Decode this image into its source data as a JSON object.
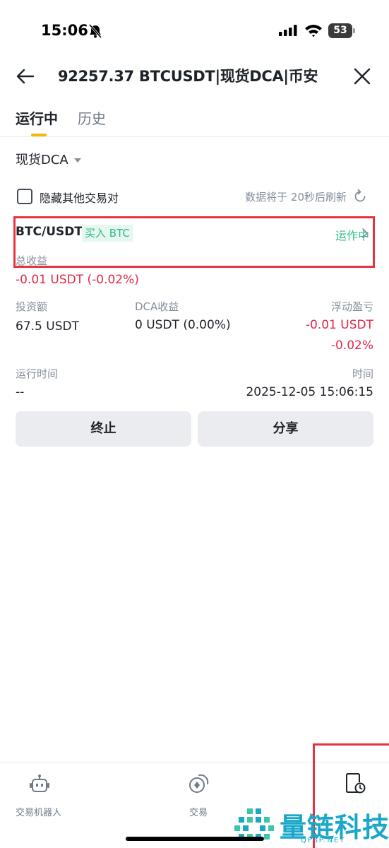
{
  "status_bar": {
    "time": "15:06",
    "battery": "53"
  },
  "nav": {
    "title": "92257.37 BTCUSDT|现货DCA|币安"
  },
  "tabs": [
    {
      "label": "运行中"
    },
    {
      "label": "历史"
    }
  ],
  "filter": {
    "label": "现货DCA"
  },
  "options": {
    "hide_label": "隐藏其他交易对",
    "refresh_text": "数据将于 20秒后刷新"
  },
  "bot": {
    "pair": "BTC/USDT",
    "side": "买入 BTC",
    "status": "运作中",
    "total_pnl_label": "总收益",
    "total_pnl_value": "-0.01 USDT (-0.02%)",
    "investment_label": "投资额",
    "investment_value": "67.5 USDT",
    "dca_pnl_label": "DCA收益",
    "dca_pnl_value": "0 USDT (0.00%)",
    "floating_label": "浮动盈亏",
    "floating_value": "-0.01 USDT",
    "floating_pct": "-0.02%",
    "runtime_label": "运行时间",
    "runtime_value": "--",
    "time_label": "时间",
    "time_value": "2025-12-05 15:06:15"
  },
  "actions": {
    "stop_label": "终止",
    "share_label": "分享"
  },
  "tabbar": {
    "items": [
      {
        "label": "交易机器人"
      },
      {
        "label": "交易"
      }
    ]
  },
  "watermark": {
    "text": "量链科技",
    "sub": "QFSP.NET"
  },
  "colors": {
    "accent": "#f0b90b",
    "positive": "#2ebd85",
    "negative": "#e0294a",
    "annotation": "#e5333f"
  }
}
